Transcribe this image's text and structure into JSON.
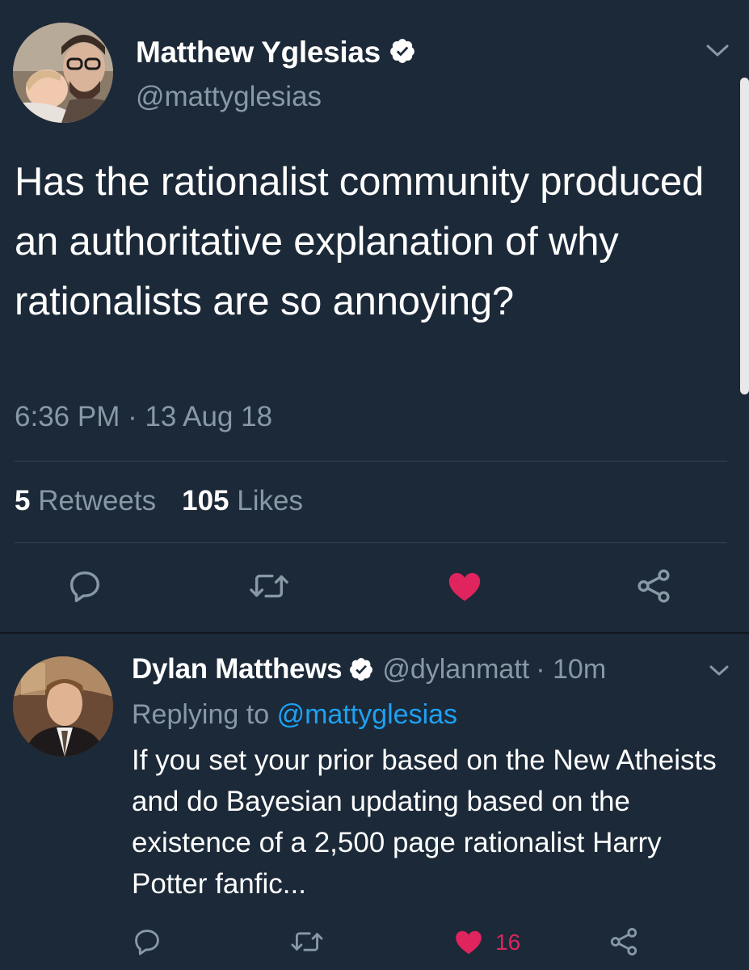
{
  "colors": {
    "background": "#1c2938",
    "secondary_text": "#8899a6",
    "link": "#1da1f2",
    "like": "#e0245e",
    "divider": "#38444d"
  },
  "main_tweet": {
    "author_name": "Matthew Yglesias",
    "handle": "@mattyglesias",
    "text": "Has the rationalist community produced an authoritative explanation of why rationalists are so annoying?",
    "timestamp": "6:36 PM · 13 Aug 18",
    "retweets_count": "5",
    "retweets_label": "Retweets",
    "likes_count": "105",
    "likes_label": "Likes",
    "icons": [
      "reply-icon",
      "retweet-icon",
      "like-icon",
      "share-icon"
    ],
    "liked": true
  },
  "reply_tweet": {
    "author_name": "Dylan Matthews",
    "handle": "@dylanmatt",
    "time_ago": "· 10m",
    "replying_to_label": "Replying to",
    "replying_to_handle": "@mattyglesias",
    "text": "If you set your prior based on the New Atheists and do Bayesian updating based on the existence of a 2,500 page rationalist Harry Potter fanfic...",
    "likes_count": "16",
    "icons": [
      "reply-icon",
      "retweet-icon",
      "like-icon",
      "share-icon"
    ],
    "liked": true
  }
}
